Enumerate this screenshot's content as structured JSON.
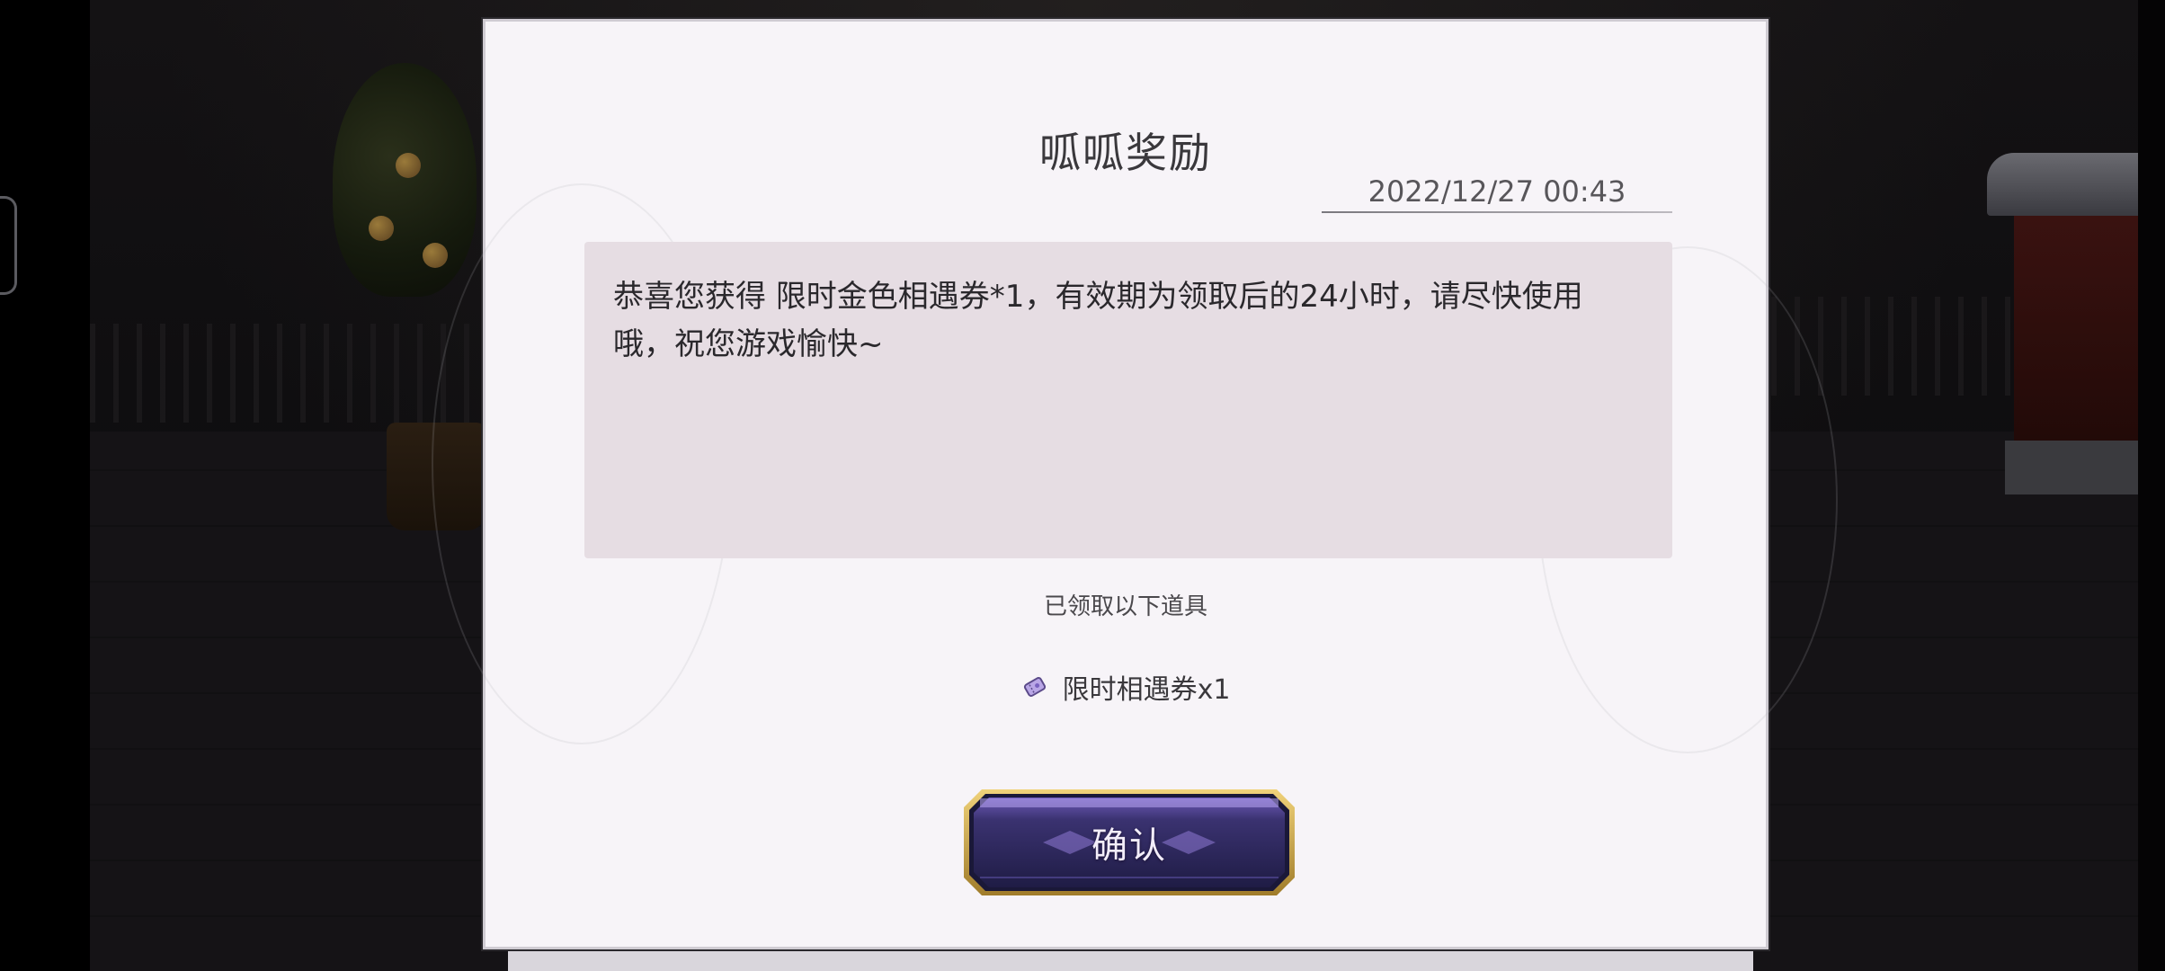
{
  "dialog": {
    "title": "呱呱奖励",
    "date": "2022/12/27 00:43",
    "message": "恭喜您获得 限时金色相遇券*1，有效期为领取后的24小时，请尽快使用哦，祝您游戏愉快~",
    "received_label": "已领取以下道具",
    "items": [
      {
        "icon": "ticket-icon",
        "label": "限时相遇券x1"
      }
    ],
    "confirm_label": "确认"
  },
  "colors": {
    "panel_bg": "#f7f4f8",
    "message_bg": "#e6dde3",
    "button_fill": "#2c2858",
    "button_border": "#c9a94a",
    "button_glow": "#8a6ad8"
  }
}
